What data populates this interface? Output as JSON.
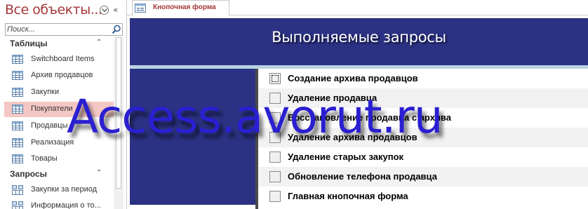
{
  "navigation_pane": {
    "title": "Все объекты...",
    "search_placeholder": "Поиск...",
    "groups": [
      {
        "label": "Таблицы",
        "items": [
          {
            "label": "Switchboard Items"
          },
          {
            "label": "Архив продавцов"
          },
          {
            "label": "Закупки"
          },
          {
            "label": "Покупатели",
            "selected": true
          },
          {
            "label": "Продавцы"
          },
          {
            "label": "Реализация"
          },
          {
            "label": "Товары"
          }
        ]
      },
      {
        "label": "Запросы",
        "items": [
          {
            "label": "Закупки за период"
          },
          {
            "label": "Информация о то..."
          }
        ]
      }
    ]
  },
  "document_tab": {
    "label": "Кнопочная форма"
  },
  "form": {
    "title": "Выполняемые запросы",
    "buttons": [
      {
        "label": "Создание архива продавцов"
      },
      {
        "label": "Удаление продавца"
      },
      {
        "label": "Восстановление продавца с архива"
      },
      {
        "label": "Удаление архива продавцов"
      },
      {
        "label": "Удаление старых закупок"
      },
      {
        "label": "Обновление телефона продавца"
      },
      {
        "label": "Главная кнопочная форма"
      }
    ]
  },
  "watermark": "Access.avorut.ru",
  "colors": {
    "accent_text": "#a4373a",
    "form_header": "#2c3283",
    "selected_item": "#f4c7c4",
    "watermark": "#2a1fd0"
  }
}
